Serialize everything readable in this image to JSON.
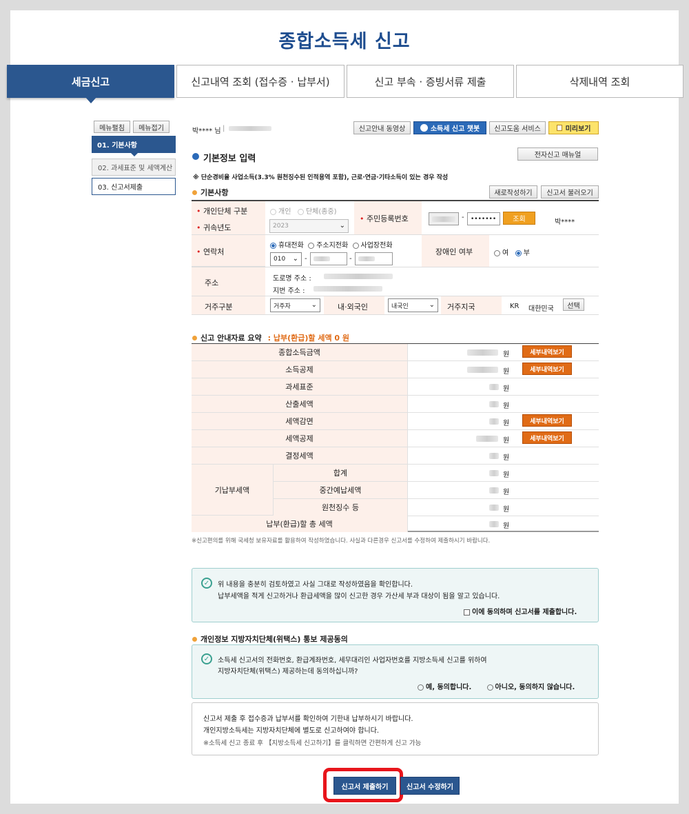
{
  "page": {
    "title": "종합소득세 신고"
  },
  "tabs": [
    {
      "label": "세금신고"
    },
    {
      "label": "신고내역 조회 (접수증 · 납부서)"
    },
    {
      "label": "신고 부속 · 증빙서류 제출"
    },
    {
      "label": "삭제내역 조회"
    }
  ],
  "sidebar": {
    "expand_label": "메뉴펼침",
    "collapse_label": "메뉴접기",
    "steps": [
      {
        "label": "01. 기본사항"
      },
      {
        "label": "02. 과세표준 및 세액계산"
      },
      {
        "label": "03. 신고서제출"
      }
    ]
  },
  "topbar": {
    "user": "박**** 님",
    "separator": "|",
    "video_btn": "신고안내 동영상",
    "chatbot_btn": "소득세 신고 챗봇",
    "help_btn": "신고도움 서비스",
    "preview_btn": "미리보기"
  },
  "basic": {
    "title": "기본정보 입력",
    "manual_btn": "전자신고 매뉴얼",
    "note": "※ 단순경비율 사업소득(3.3% 원천징수된 인적용역 포함), 근로·연금·기타소득이 있는 경우 작성",
    "section": "기본사항",
    "new_btn": "새로작성하기",
    "load_btn": "신고서 불러오기",
    "rows": {
      "type_label": "개인단체 구분",
      "type_opt1": "개인",
      "type_opt2": "단체(종중)",
      "year_label": "귀속년도",
      "year_value": "2023",
      "rrn_label": "주민등록번호",
      "rrn_mask": "•••••••",
      "dash": "-",
      "lookup_btn": "조회",
      "name_value": "박****",
      "contact_label": "연락처",
      "phone_opt1": "휴대전화",
      "phone_opt2": "주소지전화",
      "phone_opt3": "사업장전화",
      "phone_prefix": "010",
      "disability_label": "장애인 여부",
      "dis_yes": "여",
      "dis_no": "부",
      "address_label": "주소",
      "road_addr": "도로명 주소 :",
      "lot_addr": "지번 주소 :",
      "residence_label": "거주구분",
      "residence_value": "거주자",
      "nation_label": "내·외국인",
      "nation_value": "내국인",
      "country_label": "거주지국",
      "country_code": "KR",
      "country_name": "대한민국",
      "select_btn": "선택"
    }
  },
  "summary": {
    "title": "신고 안내자료 요약",
    "subtitle": ": 납부(환급)할 세액 0 원",
    "unit": "원",
    "detail_btn": "세부내역보기",
    "rows": [
      {
        "label": "종합소득금액"
      },
      {
        "label": "소득공제"
      },
      {
        "label": "과세표준"
      },
      {
        "label": "산출세액"
      },
      {
        "label": "세액감면"
      },
      {
        "label": "세액공제"
      },
      {
        "label": "결정세액"
      }
    ],
    "prepaid_label": "기납부세액",
    "prepaid_rows": [
      {
        "label": "합계"
      },
      {
        "label": "중간예납세액"
      },
      {
        "label": "원천징수 등"
      }
    ],
    "total_label": "납부(환급)할 총 세액",
    "footnote": "※신고편의를 위해 국세청 보유자료를 활용하여 작성하였습니다. 사실과 다른경우 신고서를 수정하여 제출하시기 바랍니다."
  },
  "confirm": {
    "line1": "위 내용을 충분히 검토하였고 사실 그대로 작성하였음을 확인합니다.",
    "line2": "납부세액을 적게 신고하거나 환급세액을 많이 신고한 경우 가산세 부과 대상이 됨을 알고 있습니다.",
    "agree": "이에 동의하며 신고서를 제출합니다."
  },
  "privacy": {
    "title": "개인정보 지방자치단체(위택스) 통보 제공동의",
    "line1": "소득세 신고서의 전화번호, 환급계좌번호, 세무대리인 사업자번호를 지방소득세 신고를 위하여",
    "line2": "지방자치단체(위택스) 제공하는데 동의하십니까?",
    "yes": "예, 동의합니다.",
    "no": "아니오, 동의하지 않습니다."
  },
  "notice": {
    "line1": "신고서 제출 후 접수증과 납부서를 확인하여 기한내 납부하시기 바랍니다.",
    "line2": "개인지방소득세는 지방자치단체에 별도로 신고하여야 합니다.",
    "line3": "※소득세 신고 종료 후 【지방소득세 신고하기】를 클릭하면 간편하게 신고 가능"
  },
  "actions": {
    "submit": "신고서 제출하기",
    "edit": "신고서 수정하기"
  },
  "colors": {
    "brand": "#2b578f",
    "accent": "#e06b16",
    "highlight": "#e8151b"
  }
}
